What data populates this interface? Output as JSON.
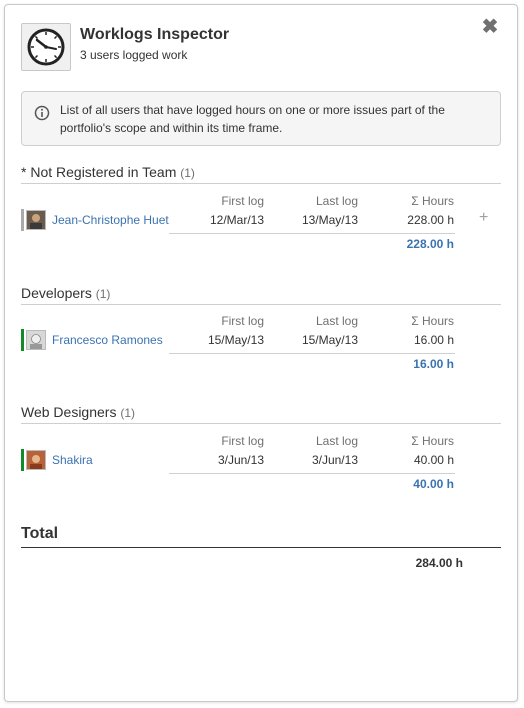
{
  "header": {
    "title": "Worklogs Inspector",
    "subtitle": "3 users logged work",
    "close_label": "✖"
  },
  "info": {
    "text": "List of all users that have logged hours on one or more issues part of the portfolio's scope and within its time frame."
  },
  "columns": {
    "first_log": "First log",
    "last_log": "Last log",
    "hours": "Σ Hours"
  },
  "groups": [
    {
      "name": "* Not Registered in Team",
      "count": "(1)",
      "bar_color": "#aaaaaa",
      "users": [
        {
          "name": "Jean-Christophe Huet",
          "first_log": "12/Mar/13",
          "last_log": "13/May/13",
          "hours": "228.00 h"
        }
      ],
      "subtotal": "228.00 h"
    },
    {
      "name": "Developers",
      "count": "(1)",
      "bar_color": "#14892c",
      "users": [
        {
          "name": "Francesco Ramones",
          "first_log": "15/May/13",
          "last_log": "15/May/13",
          "hours": "16.00 h"
        }
      ],
      "subtotal": "16.00 h"
    },
    {
      "name": "Web Designers",
      "count": "(1)",
      "bar_color": "#14892c",
      "users": [
        {
          "name": "Shakira",
          "first_log": "3/Jun/13",
          "last_log": "3/Jun/13",
          "hours": "40.00 h"
        }
      ],
      "subtotal": "40.00 h"
    }
  ],
  "total": {
    "label": "Total",
    "value": "284.00 h"
  },
  "plus_label": "+",
  "colors": {
    "link": "#3b73af",
    "muted": "#707070",
    "border": "#cfcfcf"
  }
}
